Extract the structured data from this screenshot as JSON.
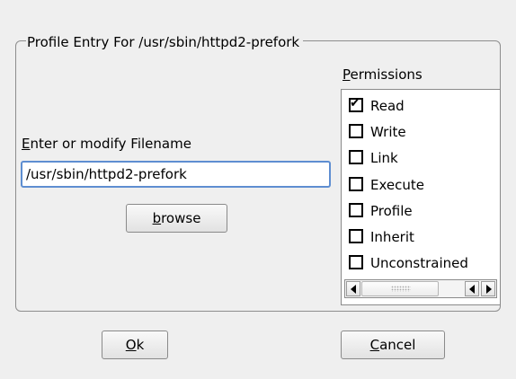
{
  "group": {
    "title": "Profile Entry For /usr/sbin/httpd2-prefork"
  },
  "filename": {
    "label_accel": "E",
    "label_rest": "nter or modify Filename",
    "value": "/usr/sbin/httpd2-prefork",
    "browse_accel": "b",
    "browse_rest": "rowse"
  },
  "permissions": {
    "label_accel": "P",
    "label_rest": "ermissions",
    "items": [
      {
        "label": "Read",
        "checked": true
      },
      {
        "label": "Write",
        "checked": false
      },
      {
        "label": "Link",
        "checked": false
      },
      {
        "label": "Execute",
        "checked": false
      },
      {
        "label": "Profile",
        "checked": false
      },
      {
        "label": "Inherit",
        "checked": false
      },
      {
        "label": "Unconstrained",
        "checked": false
      }
    ],
    "check_glyph": "✔"
  },
  "buttons": {
    "ok_accel": "O",
    "ok_rest": "k",
    "cancel_accel": "C",
    "cancel_rest": "ancel"
  },
  "colors": {
    "focus_border": "#5e8ed1",
    "window_bg": "#efefef"
  }
}
